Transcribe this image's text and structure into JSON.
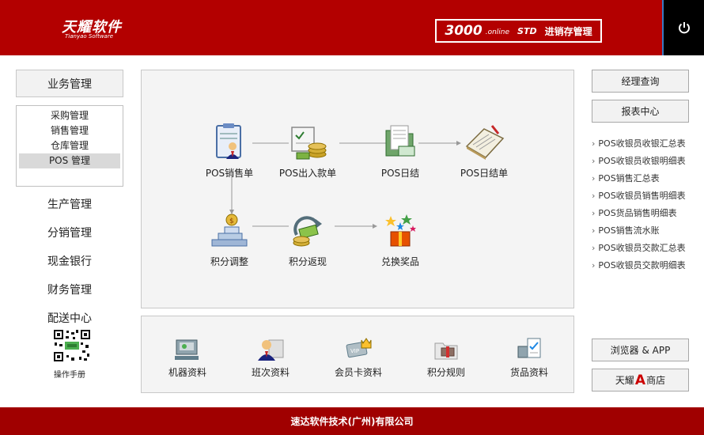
{
  "header": {
    "logo_cn": "天耀软件",
    "logo_en": "Tianyao Software",
    "product_number": "3000",
    "product_online": ".online",
    "product_std": "STD",
    "product_name": "进销存管理",
    "power_icon": "power-icon",
    "bg_color": "#b30000"
  },
  "sidebar": {
    "business_button": "业务管理",
    "sub_items": [
      "采购管理",
      "销售管理",
      "仓库管理",
      "POS 管理"
    ],
    "active_sub_item": "POS 管理",
    "nav_items": [
      "生产管理",
      "分销管理",
      "现金银行",
      "财务管理",
      "配送中心"
    ],
    "qr_label": "操作手册"
  },
  "flow": {
    "items": [
      {
        "label": "POS销售单",
        "icon": "clipboard-person-icon"
      },
      {
        "label": "POS出入款单",
        "icon": "check-coins-icon"
      },
      {
        "label": "POS日结",
        "icon": "folder-receipt-icon"
      },
      {
        "label": "POS日结单",
        "icon": "notebook-icon"
      },
      {
        "label": "积分调整",
        "icon": "stair-coins-icon"
      },
      {
        "label": "积分返现",
        "icon": "cash-return-icon"
      },
      {
        "label": "兑换奖品",
        "icon": "gift-stars-icon"
      }
    ]
  },
  "resources": {
    "items": [
      {
        "label": "机器资料",
        "icon": "machine-icon"
      },
      {
        "label": "班次资料",
        "icon": "staff-shift-icon"
      },
      {
        "label": "会员卡资料",
        "icon": "vip-card-icon"
      },
      {
        "label": "积分规则",
        "icon": "points-folder-icon"
      },
      {
        "label": "货品资料",
        "icon": "goods-checklist-icon"
      }
    ]
  },
  "right": {
    "manager_query": "经理查询",
    "report_center": "报表中心",
    "reports": [
      "POS收银员收银汇总表",
      "POS收银员收银明细表",
      "POS销售汇总表",
      "POS收银员销售明细表",
      "POS货品销售明细表",
      "POS销售流水账",
      "POS收银员交款汇总表",
      "POS收银员交款明细表"
    ],
    "browser_app": "浏览器 & APP",
    "shop_prefix": "天耀",
    "shop_mark": "A",
    "shop_suffix": "商店"
  },
  "footer": {
    "company": "速达软件技术(广州)有限公司"
  }
}
